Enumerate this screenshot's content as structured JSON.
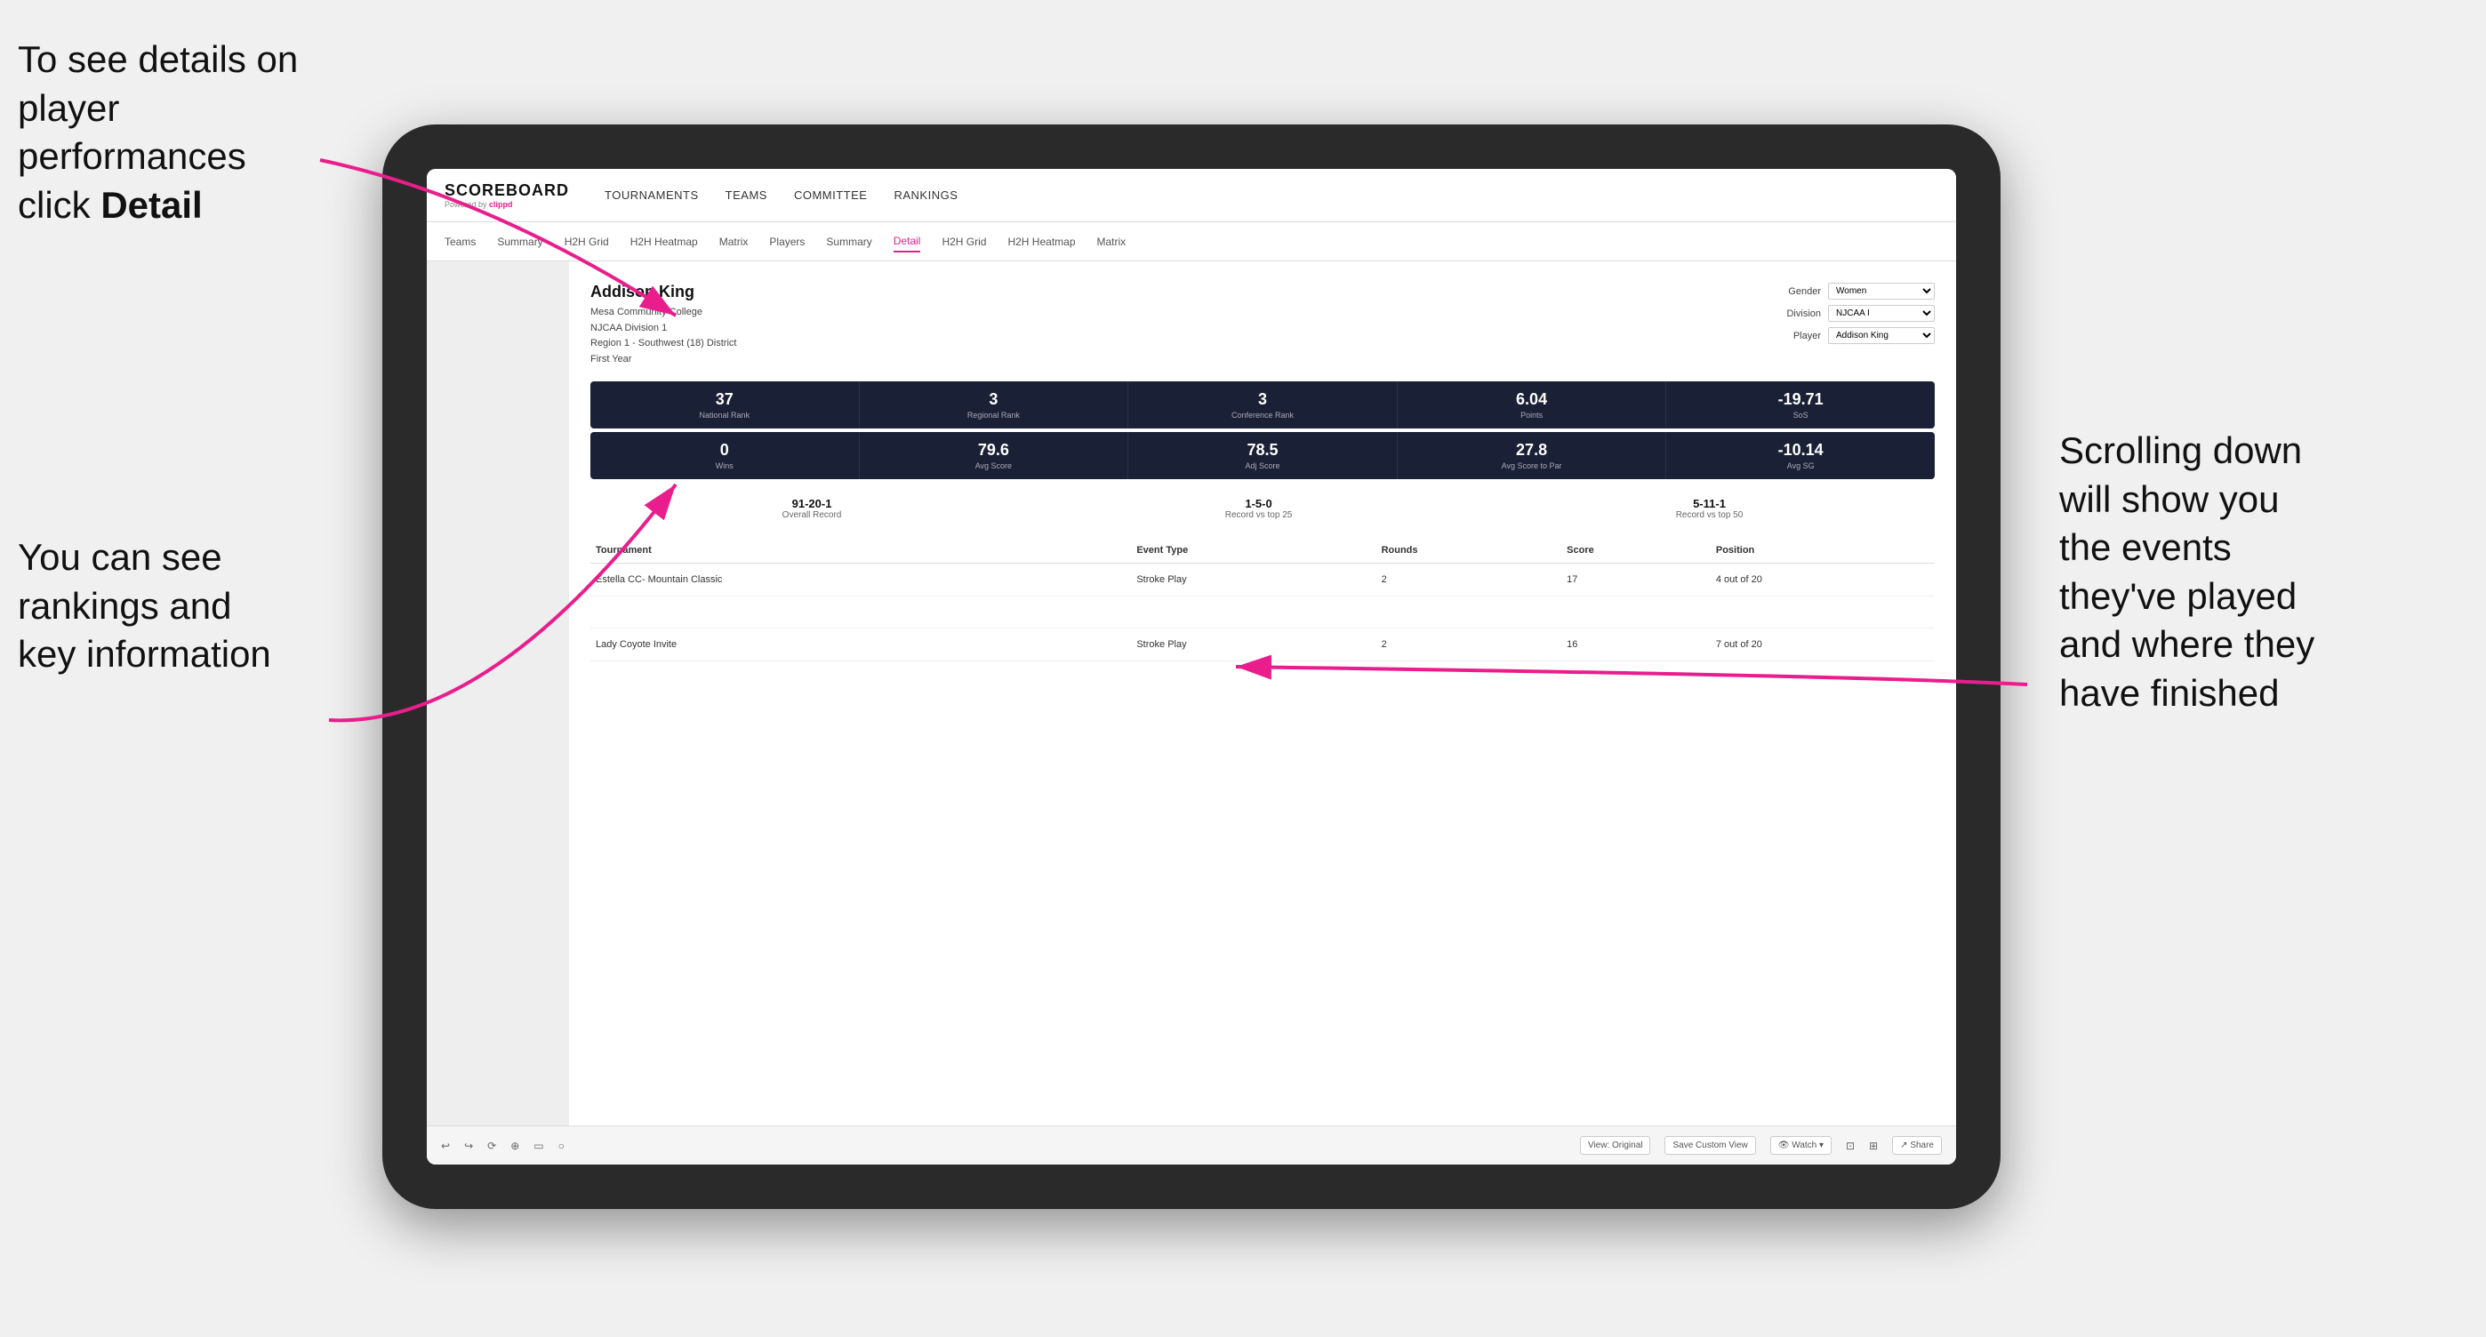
{
  "annotations": {
    "top_left": {
      "line1": "To see details on",
      "line2": "player performances",
      "line3_prefix": "click ",
      "line3_bold": "Detail"
    },
    "bottom_left": {
      "line1": "You can see",
      "line2": "rankings and",
      "line3": "key information"
    },
    "right": {
      "line1": "Scrolling down",
      "line2": "will show you",
      "line3": "the events",
      "line4": "they've played",
      "line5": "and where they",
      "line6": "have finished"
    }
  },
  "navbar": {
    "logo": "SCOREBOARD",
    "powered_by": "Powered by clippd",
    "items": [
      {
        "label": "TOURNAMENTS",
        "active": false
      },
      {
        "label": "TEAMS",
        "active": false
      },
      {
        "label": "COMMITTEE",
        "active": false
      },
      {
        "label": "RANKINGS",
        "active": false
      }
    ]
  },
  "subnav": {
    "items": [
      {
        "label": "Teams",
        "active": false
      },
      {
        "label": "Summary",
        "active": false
      },
      {
        "label": "H2H Grid",
        "active": false
      },
      {
        "label": "H2H Heatmap",
        "active": false
      },
      {
        "label": "Matrix",
        "active": false
      },
      {
        "label": "Players",
        "active": false
      },
      {
        "label": "Summary",
        "active": false
      },
      {
        "label": "Detail",
        "active": true
      },
      {
        "label": "H2H Grid",
        "active": false
      },
      {
        "label": "H2H Heatmap",
        "active": false
      },
      {
        "label": "Matrix",
        "active": false
      }
    ]
  },
  "player": {
    "name": "Addison King",
    "college": "Mesa Community College",
    "division": "NJCAA Division 1",
    "region": "Region 1 - Southwest (18) District",
    "year": "First Year"
  },
  "controls": {
    "gender_label": "Gender",
    "gender_value": "Women",
    "division_label": "Division",
    "division_value": "NJCAA I",
    "player_label": "Player",
    "player_value": "Addison King"
  },
  "stats_row1": [
    {
      "value": "37",
      "label": "National Rank"
    },
    {
      "value": "3",
      "label": "Regional Rank"
    },
    {
      "value": "3",
      "label": "Conference Rank"
    },
    {
      "value": "6.04",
      "label": "Points"
    },
    {
      "value": "-19.71",
      "label": "SoS"
    }
  ],
  "stats_row2": [
    {
      "value": "0",
      "label": "Wins"
    },
    {
      "value": "79.6",
      "label": "Avg Score"
    },
    {
      "value": "78.5",
      "label": "Adj Score"
    },
    {
      "value": "27.8",
      "label": "Avg Score to Par"
    },
    {
      "value": "-10.14",
      "label": "Avg SG"
    }
  ],
  "records": [
    {
      "value": "91-20-1",
      "label": "Overall Record"
    },
    {
      "value": "1-5-0",
      "label": "Record vs top 25"
    },
    {
      "value": "5-11-1",
      "label": "Record vs top 50"
    }
  ],
  "table": {
    "headers": [
      "Tournament",
      "Event Type",
      "Rounds",
      "Score",
      "Position"
    ],
    "rows": [
      {
        "tournament": "Estella CC- Mountain Classic",
        "event_type": "Stroke Play",
        "rounds": "2",
        "score": "17",
        "position": "4 out of 20"
      },
      {
        "tournament": "",
        "event_type": "",
        "rounds": "",
        "score": "",
        "position": ""
      },
      {
        "tournament": "Lady Coyote Invite",
        "event_type": "Stroke Play",
        "rounds": "2",
        "score": "16",
        "position": "7 out of 20"
      }
    ]
  },
  "toolbar": {
    "buttons": [
      {
        "label": "↩",
        "type": "icon"
      },
      {
        "label": "↪",
        "type": "icon"
      },
      {
        "label": "⟳",
        "type": "icon"
      },
      {
        "label": "⊕",
        "type": "icon"
      },
      {
        "label": "▭",
        "type": "icon"
      },
      {
        "label": "○",
        "type": "icon"
      },
      {
        "label": "View: Original",
        "type": "text"
      },
      {
        "label": "Save Custom View",
        "type": "text"
      },
      {
        "label": "Watch ▾",
        "type": "text"
      },
      {
        "label": "⊡",
        "type": "icon"
      },
      {
        "label": "⊞",
        "type": "icon"
      },
      {
        "label": "Share",
        "type": "text"
      }
    ]
  }
}
